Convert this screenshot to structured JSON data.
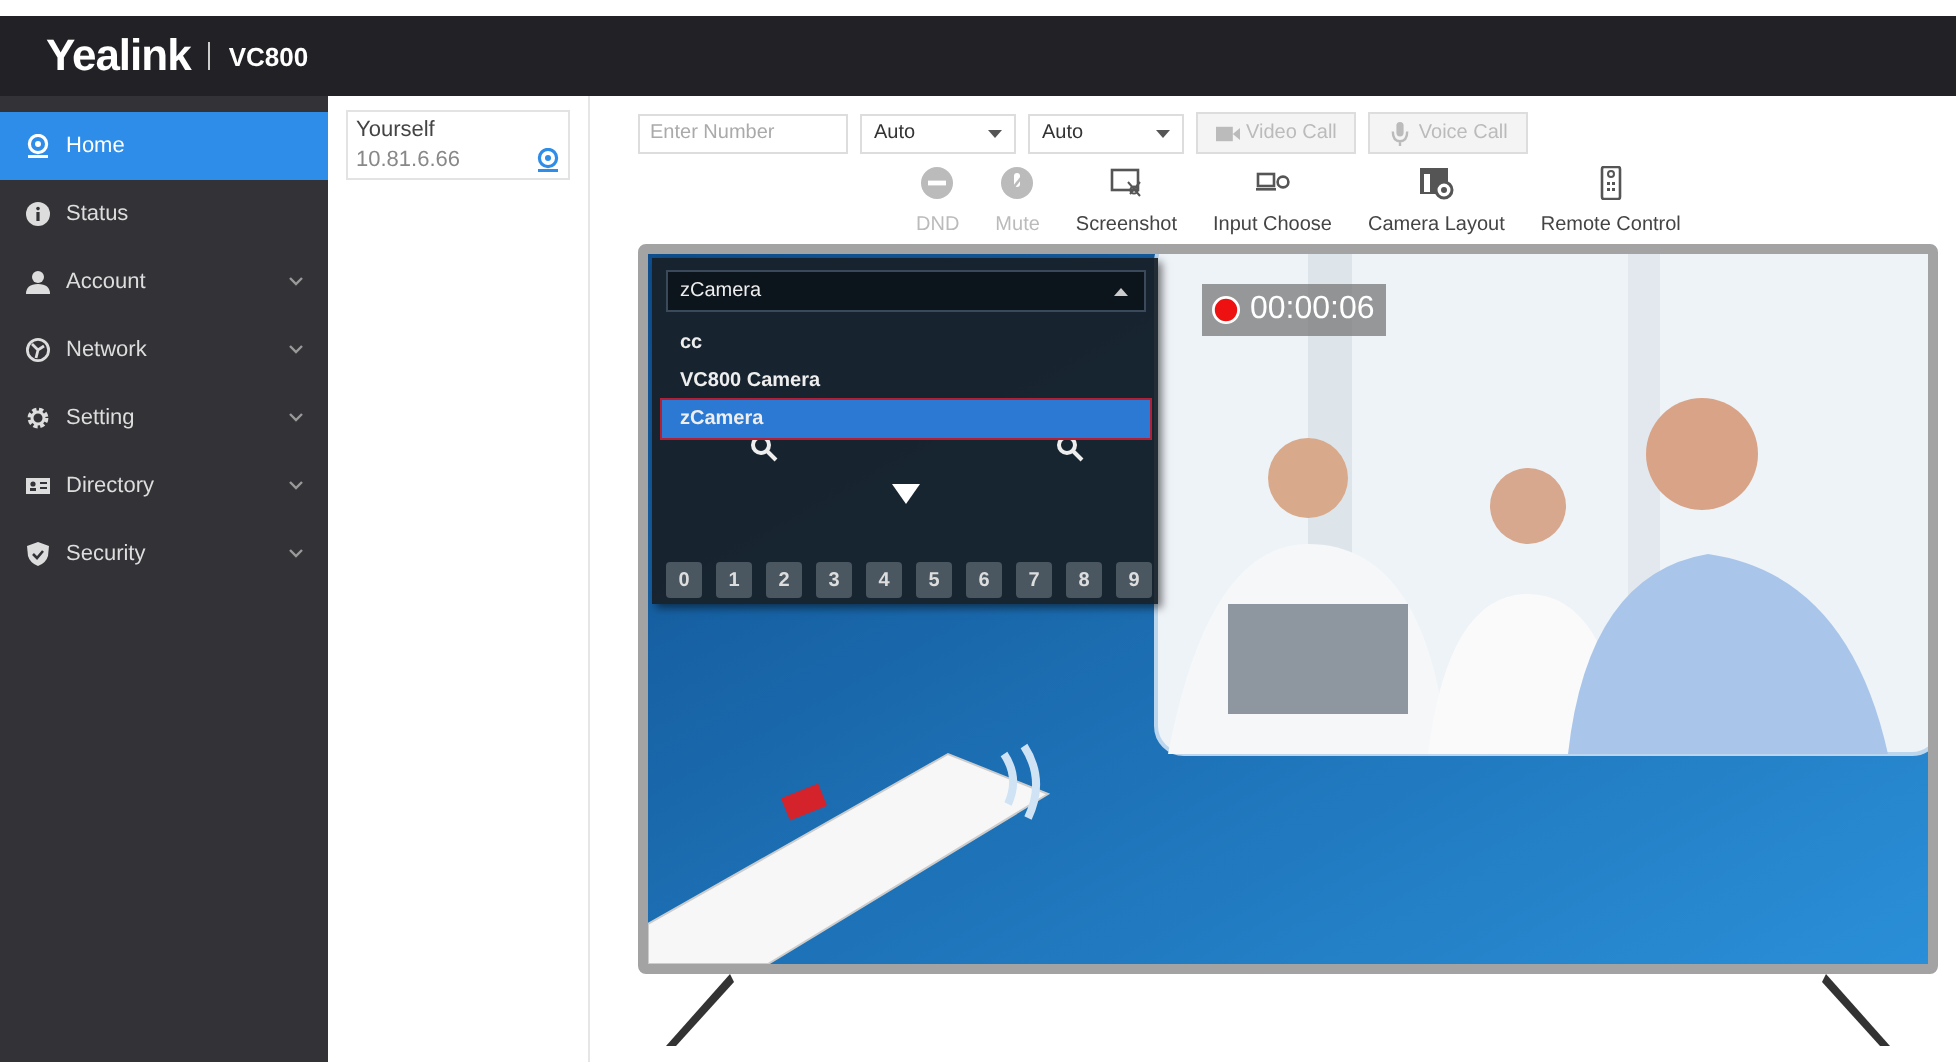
{
  "header": {
    "logo": "Yealink",
    "model": "VC800"
  },
  "sidebar": {
    "items": [
      {
        "label": "Home",
        "expandable": false,
        "selected": true
      },
      {
        "label": "Status",
        "expandable": false,
        "selected": false
      },
      {
        "label": "Account",
        "expandable": true,
        "selected": false
      },
      {
        "label": "Network",
        "expandable": true,
        "selected": false
      },
      {
        "label": "Setting",
        "expandable": true,
        "selected": false
      },
      {
        "label": "Directory",
        "expandable": true,
        "selected": false
      },
      {
        "label": "Security",
        "expandable": true,
        "selected": false
      }
    ]
  },
  "contacts": [
    {
      "name": "Yourself",
      "address": "10.81.6.66"
    }
  ],
  "call_bar": {
    "number": {
      "placeholder": "Enter Number"
    },
    "selects": [
      "Auto",
      "Auto"
    ],
    "buttons": [
      {
        "label": "Video Call",
        "disabled": true
      },
      {
        "label": "Voice Call",
        "disabled": true
      }
    ]
  },
  "tools": [
    {
      "label": "DND",
      "disabled": true
    },
    {
      "label": "Mute",
      "disabled": true
    },
    {
      "label": "Screenshot",
      "disabled": false
    },
    {
      "label": "Input Choose",
      "disabled": false
    },
    {
      "label": "Camera Layout",
      "disabled": false
    },
    {
      "label": "Remote Control",
      "disabled": false
    }
  ],
  "preview": {
    "kind": "picture",
    "camera_select": {
      "value": "zCamera",
      "expanded": true,
      "options": [
        {
          "label": "cc",
          "selected": false
        },
        {
          "label": "VC800 Camera",
          "selected": false
        },
        {
          "label": "zCamera",
          "selected": true
        }
      ]
    },
    "number_keys": [
      "0",
      "1",
      "2",
      "3",
      "4",
      "5",
      "6",
      "7",
      "8",
      "9"
    ],
    "recording": {
      "time": "00:00:06"
    }
  }
}
